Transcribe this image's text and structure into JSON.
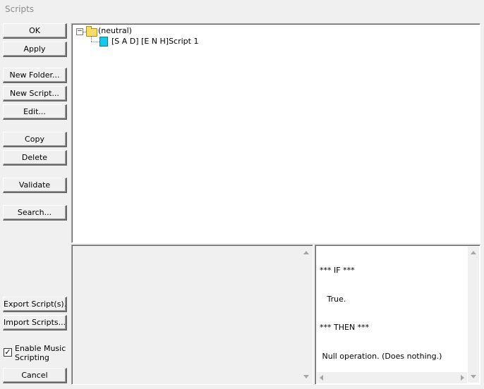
{
  "window": {
    "title": "Scripts"
  },
  "buttons": {
    "ok": "OK",
    "apply": "Apply",
    "new_folder": "New Folder...",
    "new_script": "New Script...",
    "edit": "Edit...",
    "copy": "Copy",
    "delete": "Delete",
    "validate": "Validate",
    "search": "Search...",
    "export": "Export Script(s)...",
    "import": "Import Scripts...",
    "cancel": "Cancel"
  },
  "checkbox": {
    "label": "Enable Music Scripting",
    "checked": true,
    "mark": "✓"
  },
  "tree": {
    "root": {
      "label": "(neutral)",
      "expander": "−",
      "icon": "folder-icon"
    },
    "children": [
      {
        "label": "[S A D]  [E N H]Script 1",
        "icon": "script-icon"
      }
    ]
  },
  "script_text": {
    "lines": [
      "*** IF ***",
      "   True.",
      "*** THEN ***",
      " Null operation. (Does nothing.)"
    ]
  }
}
